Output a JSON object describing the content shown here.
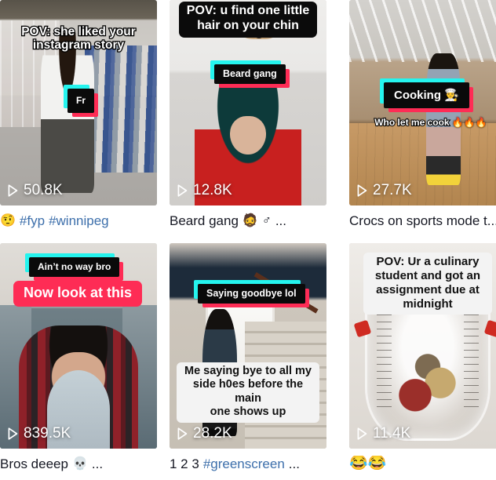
{
  "app": {
    "name": "tiktok-video-grid",
    "accent_cyan": "#25f4ee",
    "accent_pink": "#fe2c55",
    "link_color": "#3d6fab",
    "text_color": "#161823"
  },
  "grid": {
    "columns": 3,
    "rows": 2,
    "videos": [
      {
        "id": "video-1",
        "play_count": "50.8K",
        "play_icon": "play-triangle-icon",
        "overlays": {
          "top_caption": "POV: she liked your\ninstagram story",
          "sticker": "Fr"
        },
        "caption": {
          "leading_emoji": "🤨",
          "leading_emoji_name": "money-mouth-face-emoji",
          "parts": [
            {
              "text": "#fyp",
              "type": "hashtag"
            },
            {
              "text": "#winnipeg",
              "type": "hashtag"
            }
          ],
          "ellipsis": ""
        }
      },
      {
        "id": "video-2",
        "play_count": "12.8K",
        "play_icon": "play-triangle-icon",
        "overlays": {
          "top_caption": "POV: u find one little\nhair on your chin",
          "sticker": "Beard gang"
        },
        "caption": {
          "leading_emoji": "",
          "leading_emoji_name": "",
          "parts": [
            {
              "text": "Beard gang",
              "type": "text"
            },
            {
              "text": "🧔",
              "type": "emoji"
            },
            {
              "text": "♂",
              "type": "emoji"
            }
          ],
          "ellipsis": "..."
        }
      },
      {
        "id": "video-3",
        "play_count": "27.7K",
        "play_icon": "play-triangle-icon",
        "overlays": {
          "sticker": "Cooking 👨‍🍳",
          "sub_caption": "Who let me cook 🔥🔥🔥"
        },
        "caption": {
          "leading_emoji": "",
          "leading_emoji_name": "",
          "parts": [
            {
              "text": "Crocs on sports mode t...",
              "type": "text"
            }
          ],
          "ellipsis": ""
        }
      },
      {
        "id": "video-4",
        "play_count": "839.5K",
        "play_icon": "play-triangle-icon",
        "overlays": {
          "sticker": "Ain’t no way bro",
          "red_sticker": "Now look at this"
        },
        "caption": {
          "leading_emoji": "",
          "leading_emoji_name": "",
          "parts": [
            {
              "text": "Bros deeep",
              "type": "text"
            },
            {
              "text": "💀",
              "type": "emoji"
            }
          ],
          "ellipsis": "..."
        }
      },
      {
        "id": "video-5",
        "play_count": "28.2K",
        "play_icon": "play-triangle-icon",
        "overlays": {
          "sticker": "Saying goodbye lol",
          "white_caption": "Me saying bye to all my\nside h0es before the main\none shows up"
        },
        "caption": {
          "leading_emoji": "",
          "leading_emoji_name": "",
          "parts": [
            {
              "text": "1 2 3",
              "type": "text"
            },
            {
              "text": "#greenscreen",
              "type": "hashtag"
            }
          ],
          "ellipsis": "..."
        }
      },
      {
        "id": "video-6",
        "play_count": "11.4K",
        "play_icon": "play-triangle-icon",
        "overlays": {
          "white_caption": "POV: Ur a culinary\nstudent and got an\nassignment due at\nmidnight"
        },
        "caption": {
          "leading_emoji": "",
          "leading_emoji_name": "",
          "parts": [
            {
              "text": "😂😂",
              "type": "emoji"
            }
          ],
          "ellipsis": ""
        }
      }
    ]
  }
}
